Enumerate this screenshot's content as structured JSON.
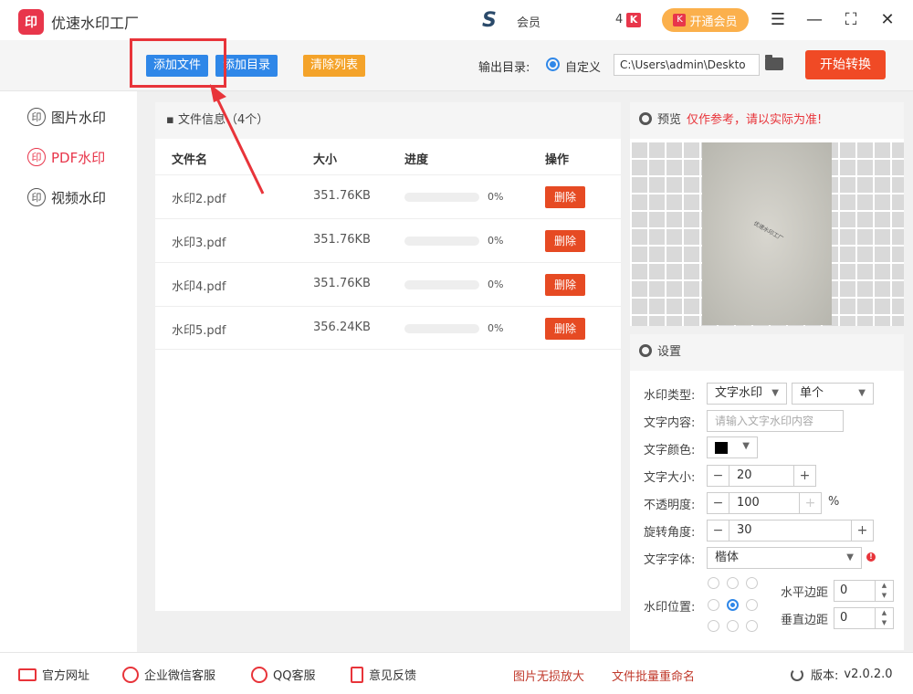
{
  "app": {
    "logo": "印",
    "title": "优速水印工厂"
  },
  "user": {
    "name": "会员",
    "count": "4",
    "vip_mark": "K"
  },
  "vip": {
    "label": "开通会员"
  },
  "window": {
    "menu": "☰",
    "minimize": "—",
    "maximize": "⛶",
    "close": "✕"
  },
  "toolbar": {
    "add_file": "添加文件",
    "add_dir": "添加目录",
    "clear_list": "清除列表",
    "output_label": "输出目录:",
    "output_option": "自定义",
    "output_path": "C:\\Users\\admin\\Deskto",
    "start": "开始转换"
  },
  "sidebar": {
    "items": [
      {
        "label": "图片水印",
        "icon": "印"
      },
      {
        "label": "PDF水印",
        "icon": "印"
      },
      {
        "label": "视频水印",
        "icon": "印"
      }
    ]
  },
  "files": {
    "header": "文件信息（4个）",
    "columns": {
      "name": "文件名",
      "size": "大小",
      "progress": "进度",
      "action": "操作"
    },
    "rows": [
      {
        "name": "水印2.pdf",
        "size": "351.76KB",
        "progress": "0%",
        "action": "删除"
      },
      {
        "name": "水印3.pdf",
        "size": "351.76KB",
        "progress": "0%",
        "action": "删除"
      },
      {
        "name": "水印4.pdf",
        "size": "351.76KB",
        "progress": "0%",
        "action": "删除"
      },
      {
        "name": "水印5.pdf",
        "size": "356.24KB",
        "progress": "0%",
        "action": "删除"
      }
    ]
  },
  "preview": {
    "title": "预览",
    "warning": "仅作参考，请以实际为准!",
    "watermark_text": "优速水印工厂"
  },
  "settings": {
    "title": "设置",
    "type_label": "水印类型:",
    "type_value": "文字水印",
    "mode_value": "单个",
    "content_label": "文字内容:",
    "content_placeholder": "请输入文字水印内容",
    "color_label": "文字颜色:",
    "size_label": "文字大小:",
    "size_value": "20",
    "opacity_label": "不透明度:",
    "opacity_value": "100",
    "opacity_unit": "%",
    "rotate_label": "旋转角度:",
    "rotate_value": "30",
    "font_label": "文字字体:",
    "font_value": "楷体",
    "position_label": "水印位置:",
    "h_margin_label": "水平边距",
    "h_margin_value": "0",
    "v_margin_label": "垂直边距",
    "v_margin_value": "0"
  },
  "footer": {
    "website": "官方网址",
    "wechat": "企业微信客服",
    "qq": "QQ客服",
    "feedback": "意见反馈",
    "link1": "图片无损放大",
    "link2": "文件批量重命名",
    "version_label": "版本:",
    "version": "v2.0.2.0"
  }
}
